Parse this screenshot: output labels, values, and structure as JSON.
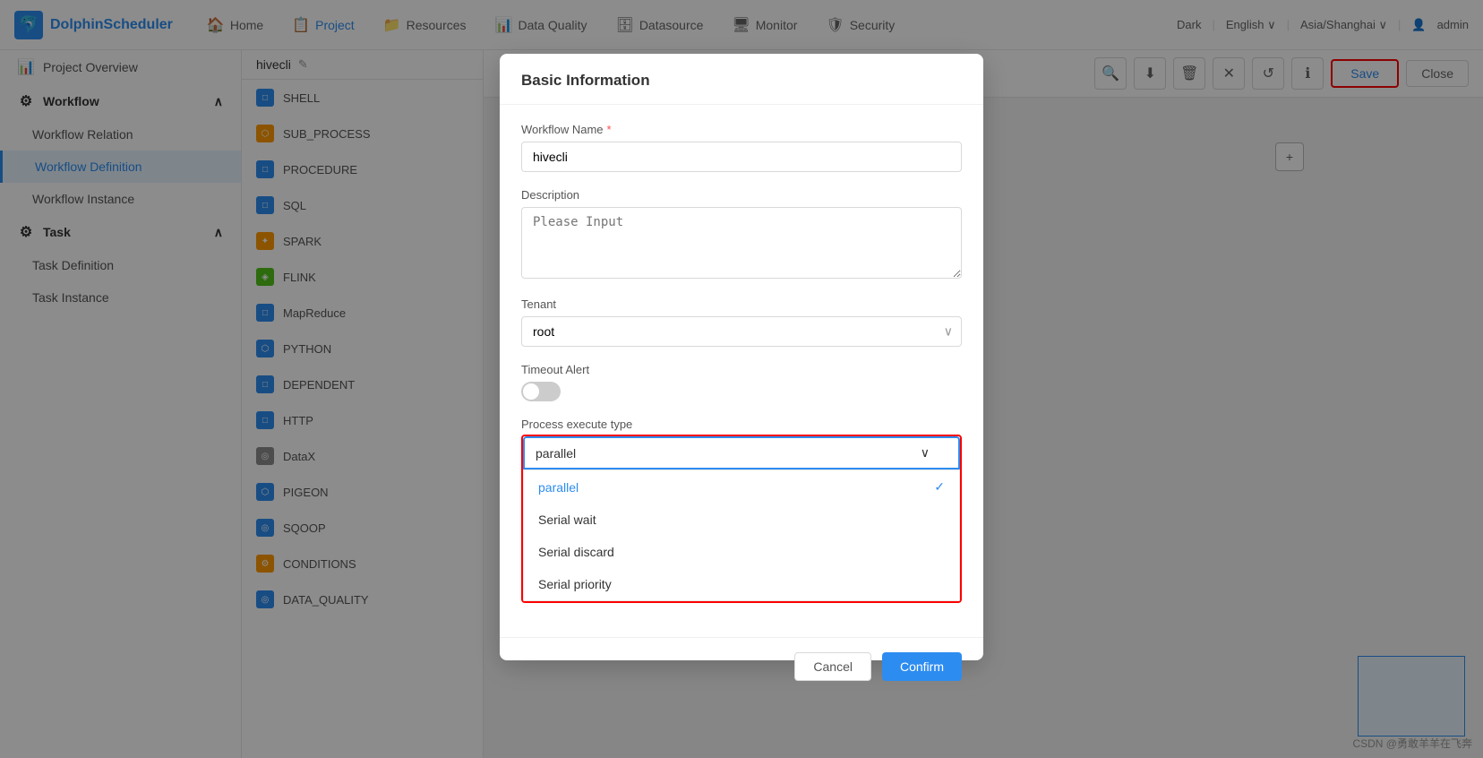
{
  "app": {
    "name": "DolphinScheduler"
  },
  "navbar": {
    "logo_text": "DolphinScheduler",
    "items": [
      {
        "id": "home",
        "label": "Home",
        "icon": "🏠",
        "active": false
      },
      {
        "id": "project",
        "label": "Project",
        "icon": "📋",
        "active": true
      },
      {
        "id": "resources",
        "label": "Resources",
        "icon": "📁",
        "active": false
      },
      {
        "id": "data_quality",
        "label": "Data Quality",
        "icon": "📊",
        "active": false
      },
      {
        "id": "datasource",
        "label": "Datasource",
        "icon": "🗄",
        "active": false
      },
      {
        "id": "monitor",
        "label": "Monitor",
        "icon": "🖥",
        "active": false
      },
      {
        "id": "security",
        "label": "Security",
        "icon": "🛡",
        "active": false
      }
    ],
    "right": {
      "theme": "Dark",
      "language": "English",
      "timezone": "Asia/Shanghai",
      "user": "admin"
    }
  },
  "sidebar": {
    "sections": [
      {
        "id": "project-overview",
        "label": "Project Overview",
        "icon": "📊",
        "type": "item"
      },
      {
        "id": "workflow",
        "label": "Workflow",
        "icon": "⚙",
        "expanded": true,
        "type": "section",
        "children": [
          {
            "id": "workflow-relation",
            "label": "Workflow Relation",
            "active": false
          },
          {
            "id": "workflow-definition",
            "label": "Workflow Definition",
            "active": true
          },
          {
            "id": "workflow-instance",
            "label": "Workflow Instance",
            "active": false
          }
        ]
      },
      {
        "id": "task",
        "label": "Task",
        "icon": "⚙",
        "expanded": true,
        "type": "section",
        "children": [
          {
            "id": "task-definition",
            "label": "Task Definition",
            "active": false
          },
          {
            "id": "task-instance",
            "label": "Task Instance",
            "active": false
          }
        ]
      }
    ]
  },
  "canvas_header": {
    "title": "hivecli",
    "tools": [
      {
        "id": "search",
        "icon": "🔍"
      },
      {
        "id": "download",
        "icon": "⬇"
      },
      {
        "id": "delete",
        "icon": "🗑"
      },
      {
        "id": "close-x",
        "icon": "✕"
      },
      {
        "id": "refresh",
        "icon": "↺"
      },
      {
        "id": "info",
        "icon": "ℹ"
      }
    ],
    "save_label": "Save",
    "close_label": "Close"
  },
  "task_types": [
    {
      "id": "shell",
      "label": "SHELL",
      "color": "blue"
    },
    {
      "id": "sub_process",
      "label": "SUB_PROCESS",
      "color": "orange"
    },
    {
      "id": "procedure",
      "label": "PROCEDURE",
      "color": "blue"
    },
    {
      "id": "sql",
      "label": "SQL",
      "color": "blue"
    },
    {
      "id": "spark",
      "label": "SPARK",
      "color": "orange"
    },
    {
      "id": "flink",
      "label": "FLINK",
      "color": "green"
    },
    {
      "id": "mapreduce",
      "label": "MapReduce",
      "color": "blue"
    },
    {
      "id": "python",
      "label": "PYTHON",
      "color": "blue"
    },
    {
      "id": "dependent",
      "label": "DEPENDENT",
      "color": "blue"
    },
    {
      "id": "http",
      "label": "HTTP",
      "color": "blue"
    },
    {
      "id": "datax",
      "label": "DataX",
      "color": "gray"
    },
    {
      "id": "pigeon",
      "label": "PIGEON",
      "color": "blue"
    },
    {
      "id": "sqoop",
      "label": "SQOOP",
      "color": "blue"
    },
    {
      "id": "conditions",
      "label": "CONDITIONS",
      "color": "orange"
    },
    {
      "id": "data_quality",
      "label": "DATA_QUALITY",
      "color": "blue"
    }
  ],
  "modal": {
    "title": "Basic Information",
    "workflow_name_label": "Workflow Name",
    "workflow_name_value": "hivecli",
    "description_label": "Description",
    "description_placeholder": "Please Input",
    "tenant_label": "Tenant",
    "tenant_value": "root",
    "timeout_alert_label": "Timeout Alert",
    "timeout_alert_on": false,
    "process_execute_type_label": "Process execute type",
    "selected_option": "parallel",
    "dropdown_options": [
      {
        "id": "parallel",
        "label": "parallel",
        "selected": true
      },
      {
        "id": "serial_wait",
        "label": "Serial wait",
        "selected": false
      },
      {
        "id": "serial_discard",
        "label": "Serial discard",
        "selected": false
      },
      {
        "id": "serial_priority",
        "label": "Serial priority",
        "selected": false
      }
    ],
    "cancel_label": "Cancel",
    "confirm_label": "Confirm"
  },
  "watermark": "CSDN @勇敢羊羊在飞奔"
}
